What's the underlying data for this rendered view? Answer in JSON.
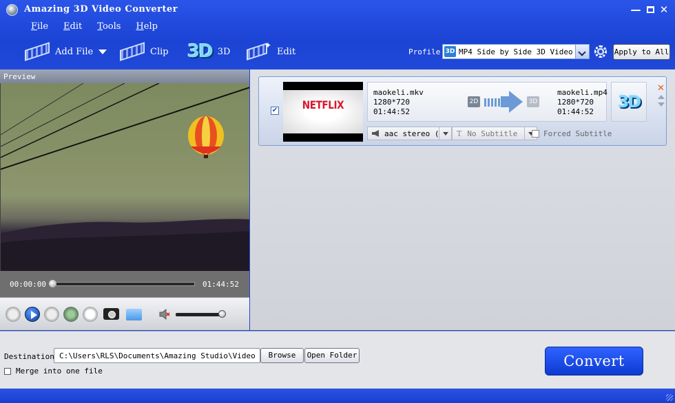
{
  "window": {
    "title": "Amazing 3D Video Converter",
    "controls": [
      "minimize",
      "maximize",
      "close"
    ]
  },
  "menu": [
    "File",
    "Edit",
    "Tools",
    "Help"
  ],
  "toolbar": {
    "add_file": "Add File",
    "clip": "Clip",
    "three_d": "3D",
    "edit": "Edit",
    "profile_label": "Profile:",
    "profile_value": "MP4 Side by Side 3D Video (",
    "apply_all": "Apply to All"
  },
  "preview": {
    "header": "Preview",
    "current_time": "00:00:00",
    "total_time": "01:44:52"
  },
  "file": {
    "thumbnail_text": "NETFLIX",
    "source_name": "maokeli.mkv",
    "source_resolution": "1280*720",
    "source_duration": "01:44:52",
    "badge_from": "2D",
    "badge_to": "3D",
    "output_name": "maokeli.mp4",
    "output_resolution": "1280*720",
    "output_duration": "01:44:52",
    "audio_track": "aac stereo (",
    "subtitle": "No Subtitle",
    "forced_subtitle": "Forced Subtitle",
    "big_3d": "3D",
    "checked": true
  },
  "bottom": {
    "destination_label": "Destination:",
    "destination_path": "C:\\Users\\RLS\\Documents\\Amazing Studio\\Video",
    "browse": "Browse",
    "open_folder": "Open Folder",
    "merge_label": "Merge into one file",
    "convert": "Convert"
  },
  "colors": {
    "chrome_blue": "#1f44d6",
    "netflix_red": "#d8182e",
    "close_x": "#e45c12"
  }
}
